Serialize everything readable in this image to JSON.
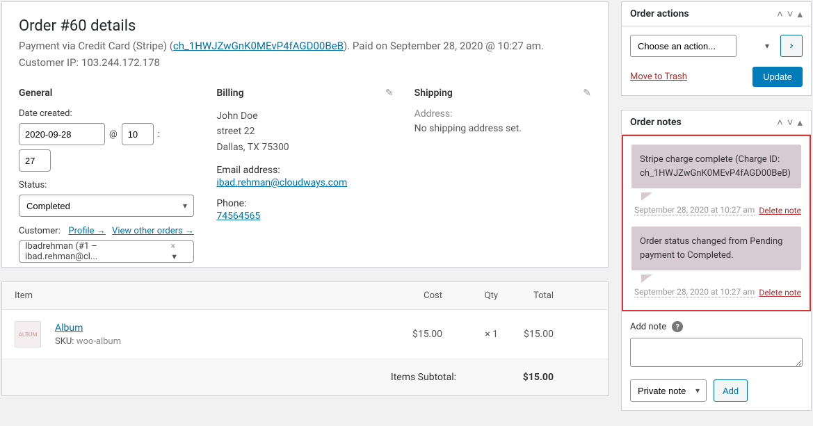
{
  "order": {
    "title": "Order #60 details",
    "subtitle_prefix": "Payment via Credit Card (Stripe) (",
    "charge_link": "ch_1HWJZwGnK0MEvP4fAGD00BeB",
    "subtitle_suffix1": "). Paid on September 28, 2020 @ 10:27 am. Customer IP: 103.244.172.178"
  },
  "general": {
    "heading": "General",
    "date_label": "Date created:",
    "date": "2020-09-28",
    "at": "@",
    "hour": "10",
    "colon": ":",
    "minute": "27",
    "status_label": "Status:",
    "status": "Completed",
    "customer_label": "Customer:",
    "profile_link": "Profile →",
    "view_orders_link": "View other orders →",
    "customer_value": "Ibadrehman (#1 – ibad.rehman@cl..."
  },
  "billing": {
    "heading": "Billing",
    "name": "John Doe",
    "street": "street 22",
    "city": "Dallas, TX 75300",
    "email_label": "Email address:",
    "email": "ibad.rehman@cloudways.com",
    "phone_label": "Phone:",
    "phone": "74564565"
  },
  "shipping": {
    "heading": "Shipping",
    "addr_label": "Address:",
    "addr_value": "No shipping address set."
  },
  "items": {
    "h_item": "Item",
    "h_cost": "Cost",
    "h_qty": "Qty",
    "h_total": "Total",
    "row": {
      "name": "Album",
      "sku_label": "SKU:",
      "sku": "woo-album",
      "cost": "$15.00",
      "qty": "× 1",
      "total": "$15.00"
    },
    "subtotal_label": "Items Subtotal:",
    "subtotal_value": "$15.00"
  },
  "actions": {
    "heading": "Order actions",
    "select": "Choose an action...",
    "trash": "Move to Trash",
    "update": "Update"
  },
  "notes": {
    "heading": "Order notes",
    "items": [
      {
        "text": "Stripe charge complete (Charge ID: ch_1HWJZwGnK0MEvP4fAGD00BeB)",
        "ts": "September 28, 2020 at 10:27 am",
        "delete": "Delete note"
      },
      {
        "text": "Order status changed from Pending payment to Completed.",
        "ts": "September 28, 2020 at 10:27 am",
        "delete": "Delete note"
      }
    ],
    "add_label": "Add note",
    "type": "Private note",
    "add_btn": "Add"
  }
}
